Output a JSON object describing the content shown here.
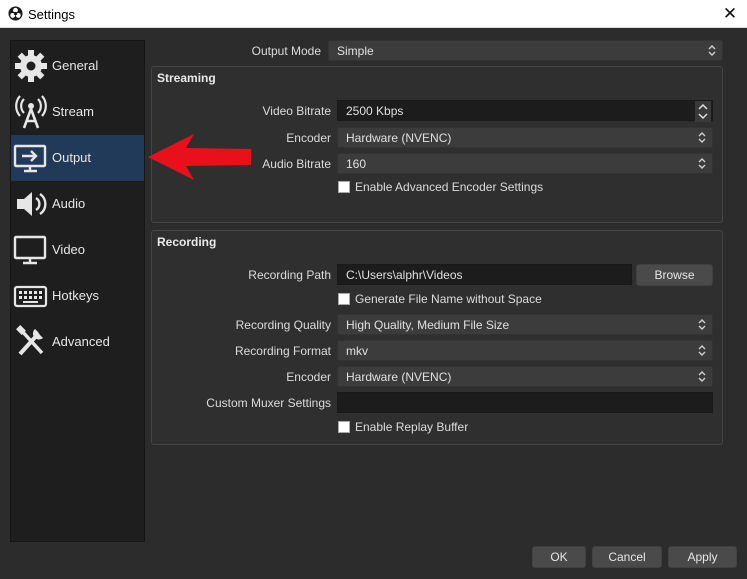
{
  "window": {
    "title": "Settings",
    "close_glyph": "✕"
  },
  "sidebar": {
    "items": [
      {
        "label": "General",
        "icon": "gear-icon"
      },
      {
        "label": "Stream",
        "icon": "antenna-icon"
      },
      {
        "label": "Output",
        "icon": "monitor-output-icon",
        "selected": true
      },
      {
        "label": "Audio",
        "icon": "speaker-icon"
      },
      {
        "label": "Video",
        "icon": "monitor-icon"
      },
      {
        "label": "Hotkeys",
        "icon": "keyboard-icon"
      },
      {
        "label": "Advanced",
        "icon": "tools-icon"
      }
    ]
  },
  "output_mode": {
    "label": "Output Mode",
    "value": "Simple"
  },
  "streaming": {
    "title": "Streaming",
    "video_bitrate": {
      "label": "Video Bitrate",
      "value": "2500 Kbps"
    },
    "encoder": {
      "label": "Encoder",
      "value": "Hardware (NVENC)"
    },
    "audio_bitrate": {
      "label": "Audio Bitrate",
      "value": "160"
    },
    "advanced_encoder": {
      "label": "Enable Advanced Encoder Settings",
      "checked": false
    }
  },
  "recording": {
    "title": "Recording",
    "path": {
      "label": "Recording Path",
      "value": "C:\\Users\\alphr\\Videos"
    },
    "browse_label": "Browse",
    "no_space": {
      "label": "Generate File Name without Space",
      "checked": false
    },
    "quality": {
      "label": "Recording Quality",
      "value": "High Quality, Medium File Size"
    },
    "format": {
      "label": "Recording Format",
      "value": "mkv"
    },
    "encoder": {
      "label": "Encoder",
      "value": "Hardware (NVENC)"
    },
    "muxer": {
      "label": "Custom Muxer Settings",
      "value": ""
    },
    "replay_buffer": {
      "label": "Enable Replay Buffer",
      "checked": false
    }
  },
  "buttons": {
    "ok": "OK",
    "cancel": "Cancel",
    "apply": "Apply"
  },
  "colors": {
    "background": "#2c2c2c",
    "sidebar": "#1e1e1e",
    "selected": "#213a5a",
    "annotation_arrow": "#e8101a"
  }
}
